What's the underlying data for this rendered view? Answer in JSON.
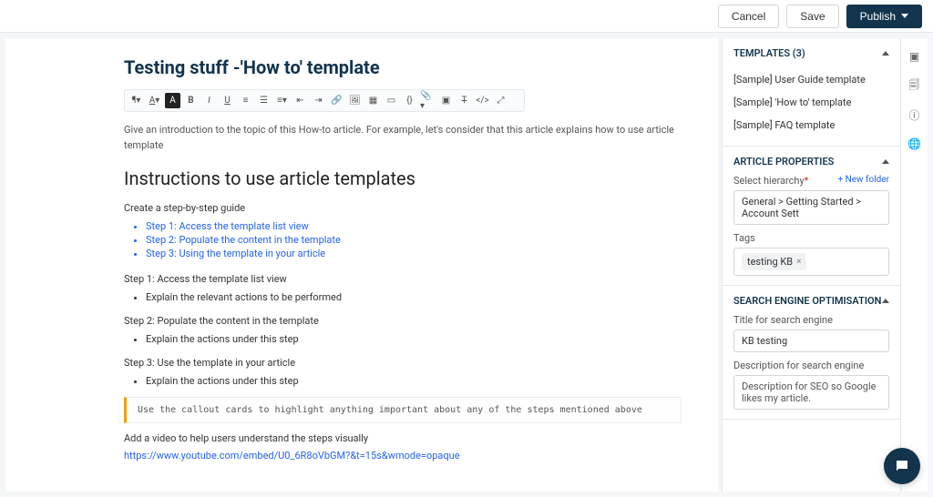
{
  "topbar": {
    "cancel": "Cancel",
    "save": "Save",
    "publish": "Publish"
  },
  "article": {
    "title": "Testing stuff -'How to' template",
    "intro": "Give an introduction to the topic of this How-to article. For example, let's consider that this article explains how to use article template",
    "section_heading": "Instructions to use article templates",
    "guide_label": "Create a step-by-step guide",
    "links": [
      "Step 1: Access the template list view",
      "Step 2: Populate the content in the template",
      "Step 3: Using the template in your article"
    ],
    "steps": [
      {
        "h": "Step 1: Access the template list view",
        "b": "Explain the relevant actions to be performed"
      },
      {
        "h": "Step 2: Populate the content in the template",
        "b": "Explain the actions under this step"
      },
      {
        "h": "Step 3: Use the template in your article",
        "b": "Explain the actions under this step"
      }
    ],
    "callout": "Use the callout cards to highlight anything important about any of the steps mentioned above",
    "video_label": "Add a video to help users understand the steps visually",
    "video_url": "https://www.youtube.com/embed/U0_6R8oVbGM?&t=15s&wmode=opaque"
  },
  "sidebar": {
    "templates": {
      "title": "TEMPLATES",
      "count": "(3)",
      "items": [
        "[Sample] User Guide template",
        "[Sample] 'How to' template",
        "[Sample] FAQ template"
      ]
    },
    "properties": {
      "title": "ARTICLE PROPERTIES",
      "hierarchy_label": "Select hierarchy",
      "new_folder": "+ New folder",
      "hierarchy_value": "General > Getting Started > Account Sett",
      "tags_label": "Tags",
      "tag": "testing KB"
    },
    "seo": {
      "title": "SEARCH ENGINE OPTIMISATION",
      "title_label": "Title for search engine",
      "title_value": "KB testing",
      "desc_label": "Description for search engine",
      "desc_value": "Description for SEO so Google likes my article."
    }
  }
}
